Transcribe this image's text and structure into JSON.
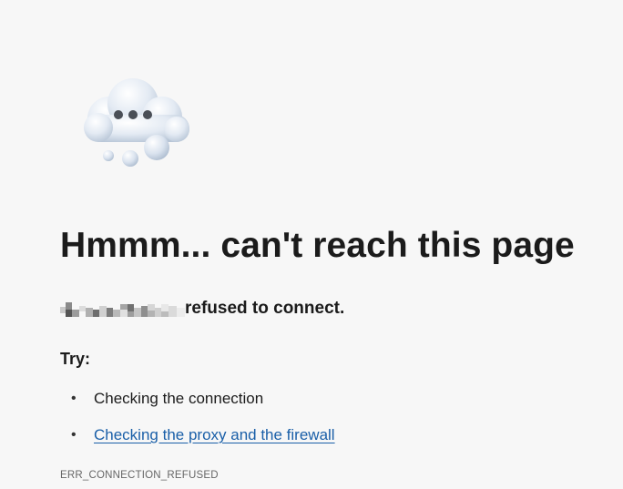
{
  "error_page": {
    "icon": "cloud-thinking-icon",
    "headline": "Hmmm... can't reach this page",
    "message_suffix": "refused to connect.",
    "try_label": "Try:",
    "suggestions": [
      {
        "label": "Checking the connection",
        "is_link": false
      },
      {
        "label": "Checking the proxy and the firewall",
        "is_link": true
      }
    ],
    "error_code": "ERR_CONNECTION_REFUSED"
  },
  "colors": {
    "background": "#f7f7f7",
    "text": "#1b1b1b",
    "link": "#1a5fa8",
    "muted": "#666666"
  }
}
